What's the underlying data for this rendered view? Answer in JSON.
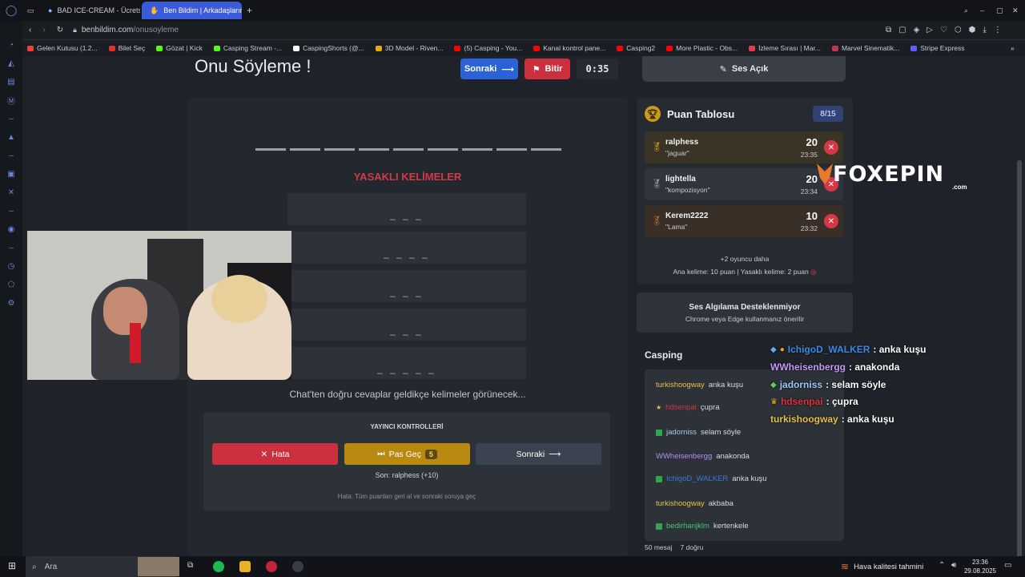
{
  "browser": {
    "tabs": [
      {
        "label": "BAD ICE-CREAM - Ücretsiz",
        "active": false
      },
      {
        "label": "Ben Bildim | Arkadaşlarınla",
        "active": true
      }
    ],
    "url_host": "benbildim.com",
    "url_path": "/onusoyleme",
    "bookmarks": [
      {
        "label": "Gelen Kutusu (1.2...",
        "color": "#ea4335"
      },
      {
        "label": "Bilet Seç",
        "color": "#e0332a"
      },
      {
        "label": "Gözat | Kick",
        "color": "#53fc18"
      },
      {
        "label": "Casping Stream -...",
        "color": "#53fc18"
      },
      {
        "label": "CaspingShorts (@...",
        "color": "#ffffff"
      },
      {
        "label": "3D Model - Riven...",
        "color": "#e6a817"
      },
      {
        "label": "(5) Casping - You...",
        "color": "#ff0000"
      },
      {
        "label": "Kanal kontrol pane...",
        "color": "#ff0000"
      },
      {
        "label": "Casping2",
        "color": "#ff0000"
      },
      {
        "label": "More Plastic - Obs...",
        "color": "#ff0000"
      },
      {
        "label": "İzleme Sırası | Mar...",
        "color": "#e03a4c"
      },
      {
        "label": "Marvel Sinematik...",
        "color": "#c0365a"
      },
      {
        "label": "Stripe Express",
        "color": "#635bff"
      }
    ]
  },
  "game": {
    "title": "Onu Söyleme !",
    "next_label": "Sonraki",
    "finish_label": "Bitir",
    "timer": "0:35",
    "sound_label": "Ses Açık",
    "forbidden_title": "YASAKLI KELİMELER",
    "forbidden_words": [
      "_ _ _",
      "_ _ _ _",
      "_ _ _",
      "_ _ _",
      "_ _ _ _ _"
    ],
    "hint": "Chat'ten doğru cevaplar geldikçe kelimeler görünecek...",
    "controls_title": "YAYINCI KONTROLLERİ",
    "error_label": "Hata",
    "skip_label": "Pas Geç",
    "skip_count": "5",
    "next2_label": "Sonraki",
    "last": "Son: ralphess (+10)",
    "error_hint": "Hata: Tüm puanları geri al ve sonraki soruya geç"
  },
  "leaderboard": {
    "title": "Puan Tablosu",
    "count": "8/15",
    "entries": [
      {
        "name": "ralphess",
        "word": "\"jaguar\"",
        "points": "20",
        "time": "23:35",
        "medal_color": "#c99a1c",
        "bg": "#3a3426"
      },
      {
        "name": "lightella",
        "word": "\"kompozisyon\"",
        "points": "20",
        "time": "23:34",
        "medal_color": "#9aa3ae",
        "bg": "#30343b"
      },
      {
        "name": "Kerem2222",
        "word": "\"Lama\"",
        "points": "10",
        "time": "23:32",
        "medal_color": "#b86b2e",
        "bg": "#3a2f26"
      }
    ],
    "more": "+2 oyuncu daha",
    "rule": "Ana kelime: 10 puan | Yasaklı kelime: 2 puan"
  },
  "warning": {
    "title": "Ses Algılama Desteklenmiyor",
    "subtitle": "Chrome veya Edge kullanmanız önerilir"
  },
  "chat": {
    "title": "Casping",
    "messages": [
      {
        "user": "turkishoogway",
        "text": "anka kuşu",
        "color": "#e8c14a"
      },
      {
        "user": "hdsenpai",
        "text": "çupra",
        "color": "#d0363f"
      },
      {
        "user": "jadorniss",
        "text": "selam söyle",
        "color": "#a7c7e7"
      },
      {
        "user": "WWheisenbergg",
        "text": "anakonda",
        "color": "#b38ef3"
      },
      {
        "user": "IchigoD_WALKER",
        "text": "anka kuşu",
        "color": "#3b78d8"
      },
      {
        "user": "turkishoogway",
        "text": "akbaba",
        "color": "#e8c14a"
      },
      {
        "user": "bedirhanjklm",
        "text": "kertenkele",
        "color": "#48c774"
      }
    ],
    "footer_messages": "50 mesaj",
    "footer_correct": "7 doğru"
  },
  "overlay_chat": [
    {
      "user": "IchigoD_WALKER",
      "text": ": anka kuşu",
      "color": "#3b8be8"
    },
    {
      "user": "WWheisenbergg",
      "text": ": anakonda",
      "color": "#c39af7"
    },
    {
      "user": "jadorniss",
      "text": ": selam söyle",
      "color": "#9cc8f2"
    },
    {
      "user": "hdsenpai",
      "text": ": çupra",
      "color": "#e0303c"
    },
    {
      "user": "turkishoogway",
      "text": ": anka kuşu",
      "color": "#e8c14a"
    }
  ],
  "logo": {
    "text": "FOXEPIN",
    "suffix": ".com"
  },
  "taskbar": {
    "search_placeholder": "Ara",
    "weather": "Hava kalitesi tahmini",
    "time": "23:36",
    "date": "29.08.2025"
  }
}
